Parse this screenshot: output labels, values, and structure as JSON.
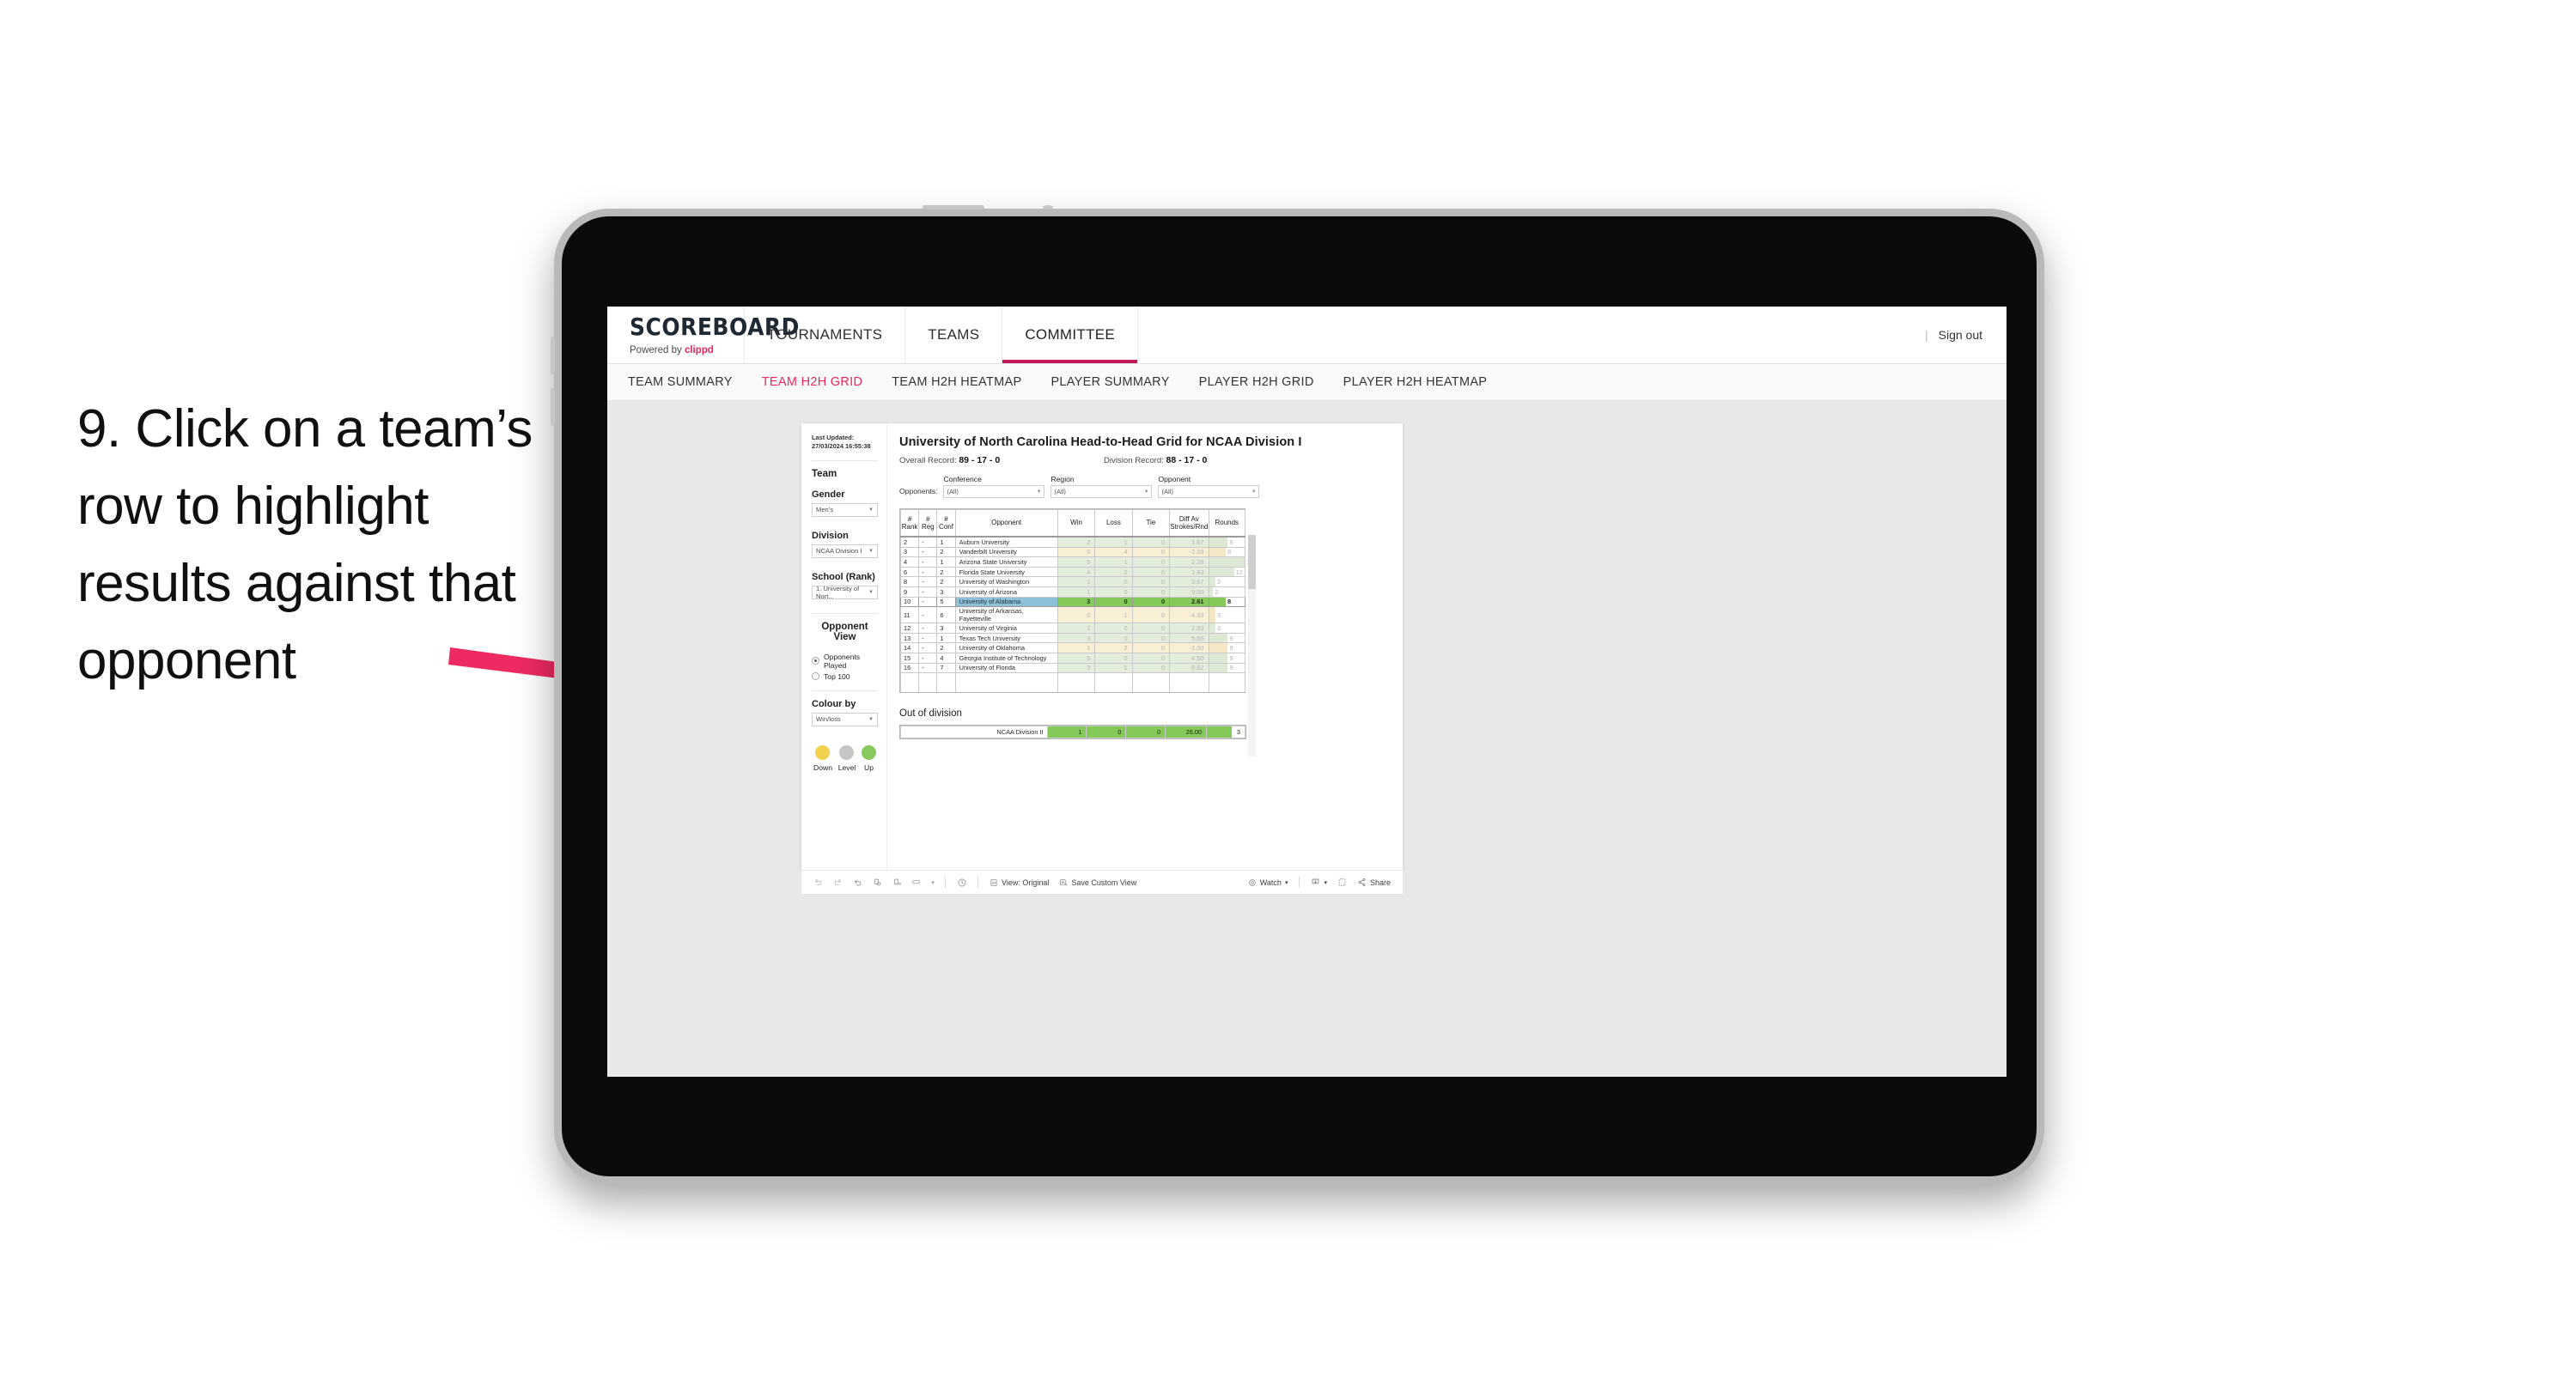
{
  "caption": "9. Click on a team’s row to highlight results against that opponent",
  "app": {
    "brand_title": "SCOREBOARD",
    "brand_sub_prefix": "Powered by ",
    "brand_sub_name": "clippd",
    "top_nav": [
      {
        "label": "TOURNAMENTS",
        "active": false
      },
      {
        "label": "TEAMS",
        "active": false
      },
      {
        "label": "COMMITTEE",
        "active": true
      }
    ],
    "sign_out": "Sign out",
    "divider": "|",
    "sub_nav": [
      {
        "label": "TEAM SUMMARY",
        "active": false
      },
      {
        "label": "TEAM H2H GRID",
        "active": true
      },
      {
        "label": "TEAM H2H HEATMAP",
        "active": false
      },
      {
        "label": "PLAYER SUMMARY",
        "active": false
      },
      {
        "label": "PLAYER H2H GRID",
        "active": false
      },
      {
        "label": "PLAYER H2H HEATMAP",
        "active": false
      }
    ]
  },
  "sidebar": {
    "last_updated": "Last Updated: 27/03/2024 16:55:38",
    "team_heading": "Team",
    "gender_label": "Gender",
    "gender_value": "Men’s",
    "division_label": "Division",
    "division_value": "NCAA Division I",
    "school_label": "School (Rank)",
    "school_value": "1. University of Nort...",
    "opponent_view_heading": "Opponent View",
    "opponent_view_options": [
      {
        "label": "Opponents Played",
        "selected": true
      },
      {
        "label": "Top 100",
        "selected": false
      }
    ],
    "colour_by_label": "Colour by",
    "colour_by_value": "Win/loss",
    "legend": [
      {
        "label": "Down",
        "color": "#f2d14f"
      },
      {
        "label": "Level",
        "color": "#c4c6c8"
      },
      {
        "label": "Up",
        "color": "#87c95c"
      }
    ]
  },
  "viz": {
    "title": "University of North Carolina Head-to-Head Grid for NCAA Division I",
    "overall_record_label": "Overall Record:",
    "overall_record_value": "89 - 17 - 0",
    "division_record_label": "Division Record:",
    "division_record_value": "88 - 17 - 0",
    "opponents_label": "Opponents:",
    "filters": [
      {
        "caption": "Conference",
        "value": "(All)"
      },
      {
        "caption": "Region",
        "value": "(All)"
      },
      {
        "caption": "Opponent",
        "value": "(All)"
      }
    ],
    "out_of_division_label": "Out of division"
  },
  "chart_data": {
    "type": "table",
    "title": "University of North Carolina Head-to-Head Grid for NCAA Division I",
    "columns": [
      "# Rank",
      "# Reg",
      "# Conf",
      "Opponent",
      "Win",
      "Loss",
      "Tie",
      "Diff Av Strokes/Rnd",
      "Rounds"
    ],
    "column_lines": [
      [
        "#",
        "Rank"
      ],
      [
        "#",
        "Reg"
      ],
      [
        "#",
        "Conf"
      ],
      [
        "Opponent"
      ],
      [
        "Win"
      ],
      [
        "Loss"
      ],
      [
        "Tie"
      ],
      [
        "Diff Av",
        "Strokes/Rnd"
      ],
      [
        "Rounds"
      ]
    ],
    "rows": [
      {
        "rank": "2",
        "reg": "-",
        "conf": "1",
        "opponent": "Auburn University",
        "win": "2",
        "loss": "1",
        "tie": "0",
        "diff": "1.67",
        "rounds": "9",
        "result": "up",
        "selected": false
      },
      {
        "rank": "3",
        "reg": "-",
        "conf": "2",
        "opponent": "Vanderbilt University",
        "win": "0",
        "loss": "4",
        "tie": "0",
        "diff": "-2.29",
        "rounds": "8",
        "result": "down",
        "selected": false
      },
      {
        "rank": "4",
        "reg": "-",
        "conf": "1",
        "opponent": "Arizona State University",
        "win": "5",
        "loss": "1",
        "tie": "0",
        "diff": "2.28",
        "rounds": "17",
        "result": "up",
        "selected": false
      },
      {
        "rank": "6",
        "reg": "-",
        "conf": "2",
        "opponent": "Florida State University",
        "win": "4",
        "loss": "2",
        "tie": "0",
        "diff": "1.83",
        "rounds": "12",
        "result": "up",
        "selected": false
      },
      {
        "rank": "8",
        "reg": "-",
        "conf": "2",
        "opponent": "University of Washington",
        "win": "1",
        "loss": "0",
        "tie": "0",
        "diff": "3.67",
        "rounds": "3",
        "result": "up",
        "selected": false
      },
      {
        "rank": "9",
        "reg": "-",
        "conf": "3",
        "opponent": "University of Arizona",
        "win": "1",
        "loss": "0",
        "tie": "0",
        "diff": "9.00",
        "rounds": "2",
        "result": "up",
        "selected": false
      },
      {
        "rank": "10",
        "reg": "-",
        "conf": "5",
        "opponent": "University of Alabama",
        "win": "3",
        "loss": "0",
        "tie": "0",
        "diff": "2.61",
        "rounds": "8",
        "result": "up",
        "selected": true
      },
      {
        "rank": "11",
        "reg": "-",
        "conf": "6",
        "opponent": "University of Arkansas, Fayetteville",
        "win": "0",
        "loss": "1",
        "tie": "0",
        "diff": "-4.33",
        "rounds": "3",
        "result": "down",
        "selected": false
      },
      {
        "rank": "12",
        "reg": "-",
        "conf": "3",
        "opponent": "University of Virginia",
        "win": "1",
        "loss": "0",
        "tie": "0",
        "diff": "2.33",
        "rounds": "3",
        "result": "up",
        "selected": false
      },
      {
        "rank": "13",
        "reg": "-",
        "conf": "1",
        "opponent": "Texas Tech University",
        "win": "3",
        "loss": "0",
        "tie": "0",
        "diff": "5.56",
        "rounds": "9",
        "result": "up",
        "selected": false
      },
      {
        "rank": "14",
        "reg": "-",
        "conf": "2",
        "opponent": "University of Oklahoma",
        "win": "1",
        "loss": "2",
        "tie": "0",
        "diff": "-1.00",
        "rounds": "9",
        "result": "down",
        "selected": false
      },
      {
        "rank": "15",
        "reg": "-",
        "conf": "4",
        "opponent": "Georgia Institute of Technology",
        "win": "5",
        "loss": "0",
        "tie": "0",
        "diff": "4.50",
        "rounds": "9",
        "result": "up",
        "selected": false
      },
      {
        "rank": "16",
        "reg": "-",
        "conf": "7",
        "opponent": "University of Florida",
        "win": "3",
        "loss": "1",
        "tie": "0",
        "diff": "6.62",
        "rounds": "9",
        "result": "up",
        "selected": false
      }
    ],
    "out_of_division": [
      {
        "label": "NCAA Division II",
        "win": "1",
        "loss": "0",
        "tie": "0",
        "diff": "26.00",
        "rounds": "3",
        "result": "up"
      }
    ],
    "rounds_max": 17
  },
  "toolbar": {
    "view_label": "View: Original",
    "save_label": "Save Custom View",
    "watch_label": "Watch",
    "share_label": "Share",
    "caret": "▾"
  }
}
